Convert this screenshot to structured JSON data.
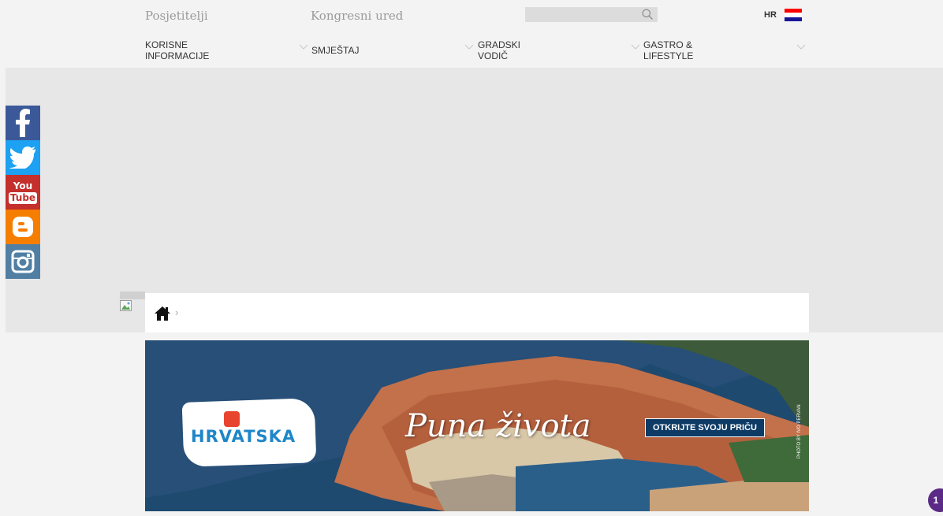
{
  "header": {
    "links": [
      {
        "label": "Posjetitelji"
      },
      {
        "label": "Kongresni ured"
      }
    ],
    "search": {
      "placeholder": "",
      "value": ""
    },
    "language": "HR"
  },
  "nav": {
    "items": [
      {
        "label_line1": "KORISNE",
        "label_line2": "INFORMACIJE"
      },
      {
        "label_line1": "SMJEŠTAJ",
        "label_line2": ""
      },
      {
        "label_line1": "GRADSKI",
        "label_line2": "VODIČ"
      },
      {
        "label_line1": "GASTRO &",
        "label_line2": "LIFESTYLE"
      }
    ]
  },
  "social": {
    "icons": [
      "facebook-icon",
      "twitter-icon",
      "youtube-icon",
      "blogger-icon",
      "instagram-icon"
    ],
    "youtube_line1": "You",
    "youtube_line2": "Tube"
  },
  "breadcrumb": {
    "home_icon": "home-icon",
    "separator": "›"
  },
  "banner": {
    "logo_text": "HRVATSKA",
    "tagline": "Puna života",
    "cta_label": "OTKRIJTE SVOJU PRIČU",
    "photo_credit": "PHOTO BY IVO PERVAN"
  },
  "notification_badge": "1",
  "colors": {
    "facebook": "#3b5998",
    "twitter": "#1da1f2",
    "youtube": "#c4302b",
    "blogger": "#f57d00",
    "instagram": "#517fa4",
    "cta": "#0d3b66",
    "badge": "#5b2a86"
  }
}
